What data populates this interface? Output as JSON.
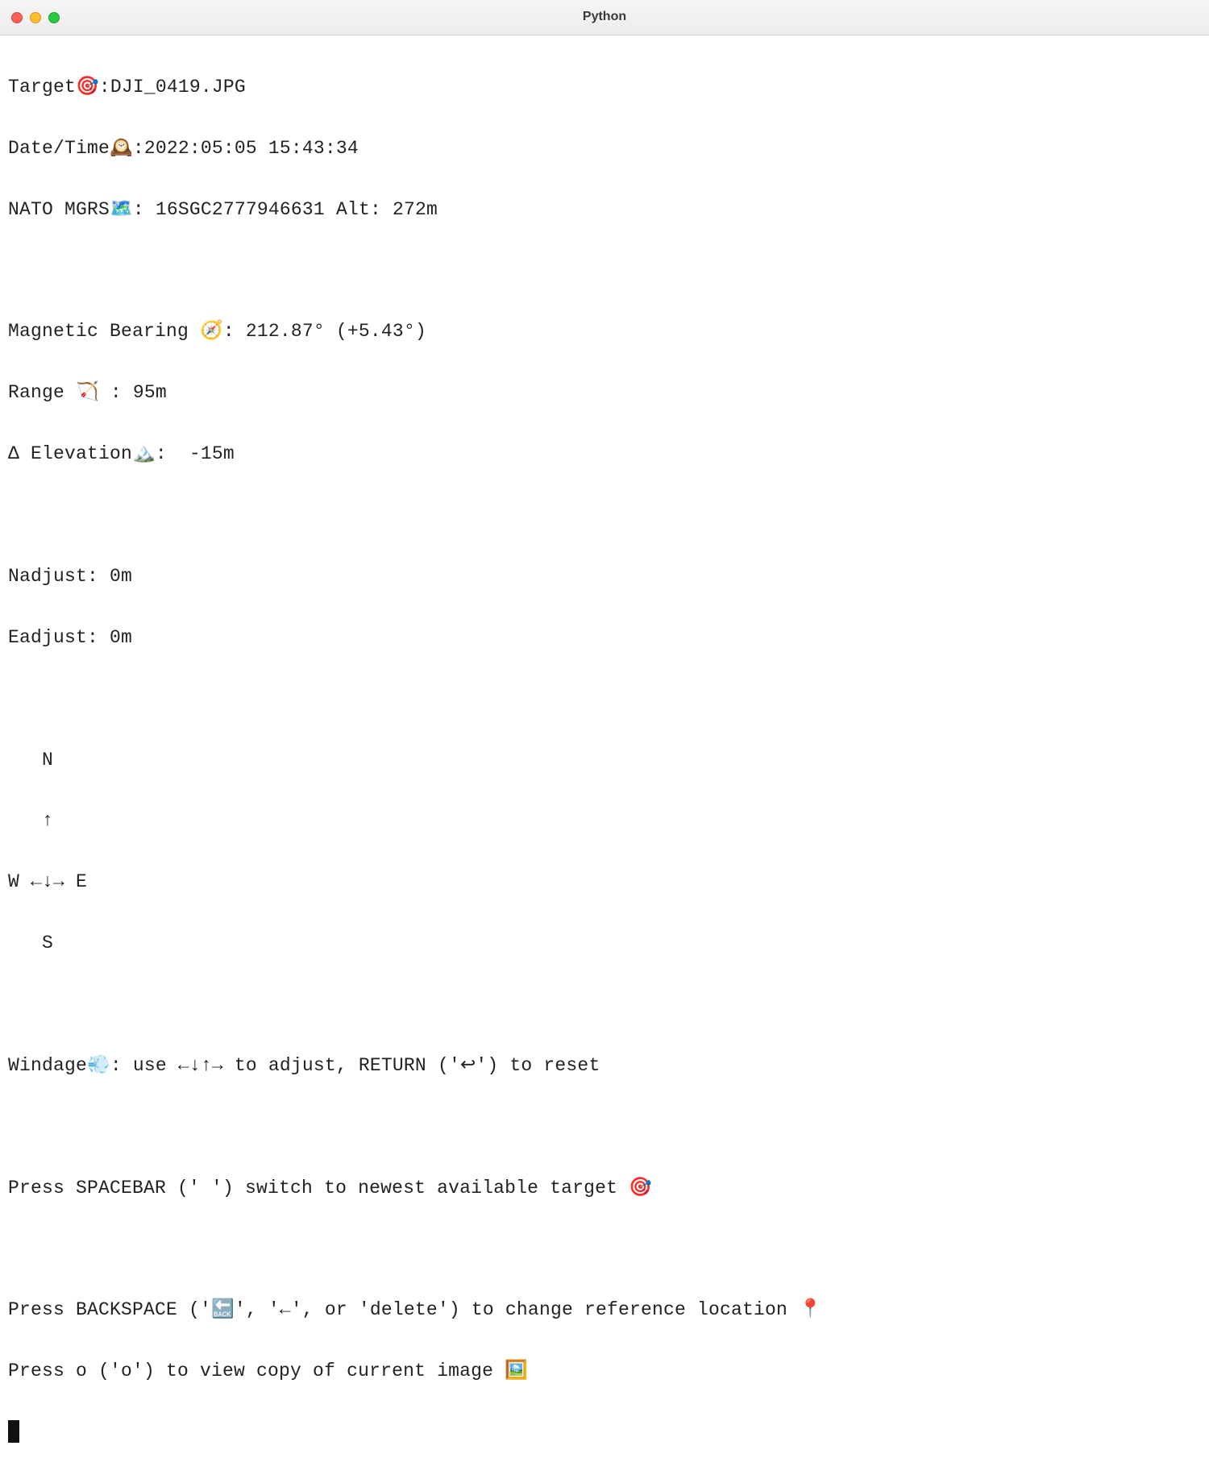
{
  "window": {
    "title": "Python"
  },
  "target": {
    "label": "Target",
    "icon": "🎯",
    "sep": ":",
    "value": "DJI_0419.JPG"
  },
  "datetime": {
    "label": "Date/Time",
    "icon": "🕰️",
    "sep": ":",
    "value": "2022:05:05 15:43:34"
  },
  "mgrs": {
    "label": "NATO MGRS",
    "icon": "🗺️",
    "sep": ": ",
    "value": "16SGC2777946631",
    "alt_label": " Alt: ",
    "alt_value": "272m"
  },
  "bearing": {
    "label": "Magnetic Bearing ",
    "icon": "🧭",
    "sep": ": ",
    "value": "212.87° (+5.43°)"
  },
  "range": {
    "label": "Range ",
    "icon": "🏹",
    "sep": " : ",
    "value": "95m"
  },
  "elevation": {
    "label": "Δ Elevation",
    "icon": "🏔️",
    "sep": ": ",
    "value": " -15m"
  },
  "nadjust": {
    "label": "Nadjust: ",
    "value": "0m"
  },
  "eadjust": {
    "label": "Eadjust: ",
    "value": "0m"
  },
  "compass": {
    "line1": "   N",
    "line2": "   ↑",
    "line3": "W ←↓→ E",
    "line4": "   S"
  },
  "windage": {
    "label": "Windage",
    "icon": "💨",
    "text": ": use ←↓↑→ to adjust, RETURN ('↩') to reset"
  },
  "help": {
    "spacebar": "Press SPACEBAR (' ') switch to newest available target 🎯",
    "backspace": "Press BACKSPACE ('🔙', '←', or 'delete') to change reference location 📍",
    "o": "Press o ('o') to view copy of current image 🖼️"
  }
}
